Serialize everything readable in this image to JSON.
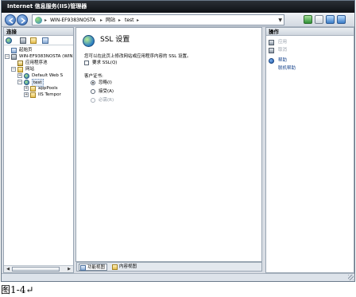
{
  "window": {
    "title": "Internet 信息服务(IIS)管理器"
  },
  "address": {
    "crumbs": [
      "WIN-EF9383NOSTA",
      "网站",
      "test"
    ],
    "separators": [
      "▸",
      "▸",
      "▸"
    ]
  },
  "connections": {
    "title": "连接",
    "tree": [
      {
        "label": "起始页",
        "icon": "home-icon",
        "level": 0
      },
      {
        "label": "WIN-EF9383NOSTA (WIN",
        "icon": "server-icon",
        "level": 0,
        "expander": "−"
      },
      {
        "label": "应用程序池",
        "icon": "app-pool-icon",
        "level": 1
      },
      {
        "label": "网站",
        "icon": "sites-folder-icon",
        "level": 1,
        "expander": "−"
      },
      {
        "label": "Default Web S",
        "icon": "globe-icon",
        "level": 2,
        "expander": "+"
      },
      {
        "label": "test",
        "icon": "globe-icon",
        "level": 2,
        "expander": "−",
        "selected": true
      },
      {
        "label": "appPools",
        "icon": "folder-icon",
        "level": 3,
        "expander": "+"
      },
      {
        "label": "IIS Tempor",
        "icon": "folder-icon",
        "level": 3,
        "expander": "+"
      }
    ]
  },
  "main": {
    "title": "SSL 设置",
    "description": "您可以在此页上修改网站或应用程序内容的 SSL 设置。",
    "require_ssl_label": "要求 SSL(Q)",
    "client_cert_label": "客户证书:",
    "radios": [
      {
        "label": "忽略(I)",
        "checked": true,
        "disabled": false
      },
      {
        "label": "接受(A)",
        "checked": false,
        "disabled": false
      },
      {
        "label": "必需(R)",
        "checked": false,
        "disabled": true
      }
    ]
  },
  "view_tabs": {
    "features_view": "功能视图",
    "content_view": "内容视图"
  },
  "actions": {
    "title": "操作",
    "items": [
      {
        "label": "应用",
        "icon": "apply-icon",
        "enabled": false
      },
      {
        "label": "取消",
        "icon": "cancel-icon",
        "enabled": false
      },
      {
        "label": "帮助",
        "icon": "help-icon",
        "enabled": true
      },
      {
        "label": "联机帮助",
        "icon": "",
        "enabled": true
      }
    ]
  },
  "caption": "图1-4↵",
  "colors": {
    "title_bar": "#1b1f24",
    "selection": "#dfe8f3",
    "link": "#15428b"
  }
}
